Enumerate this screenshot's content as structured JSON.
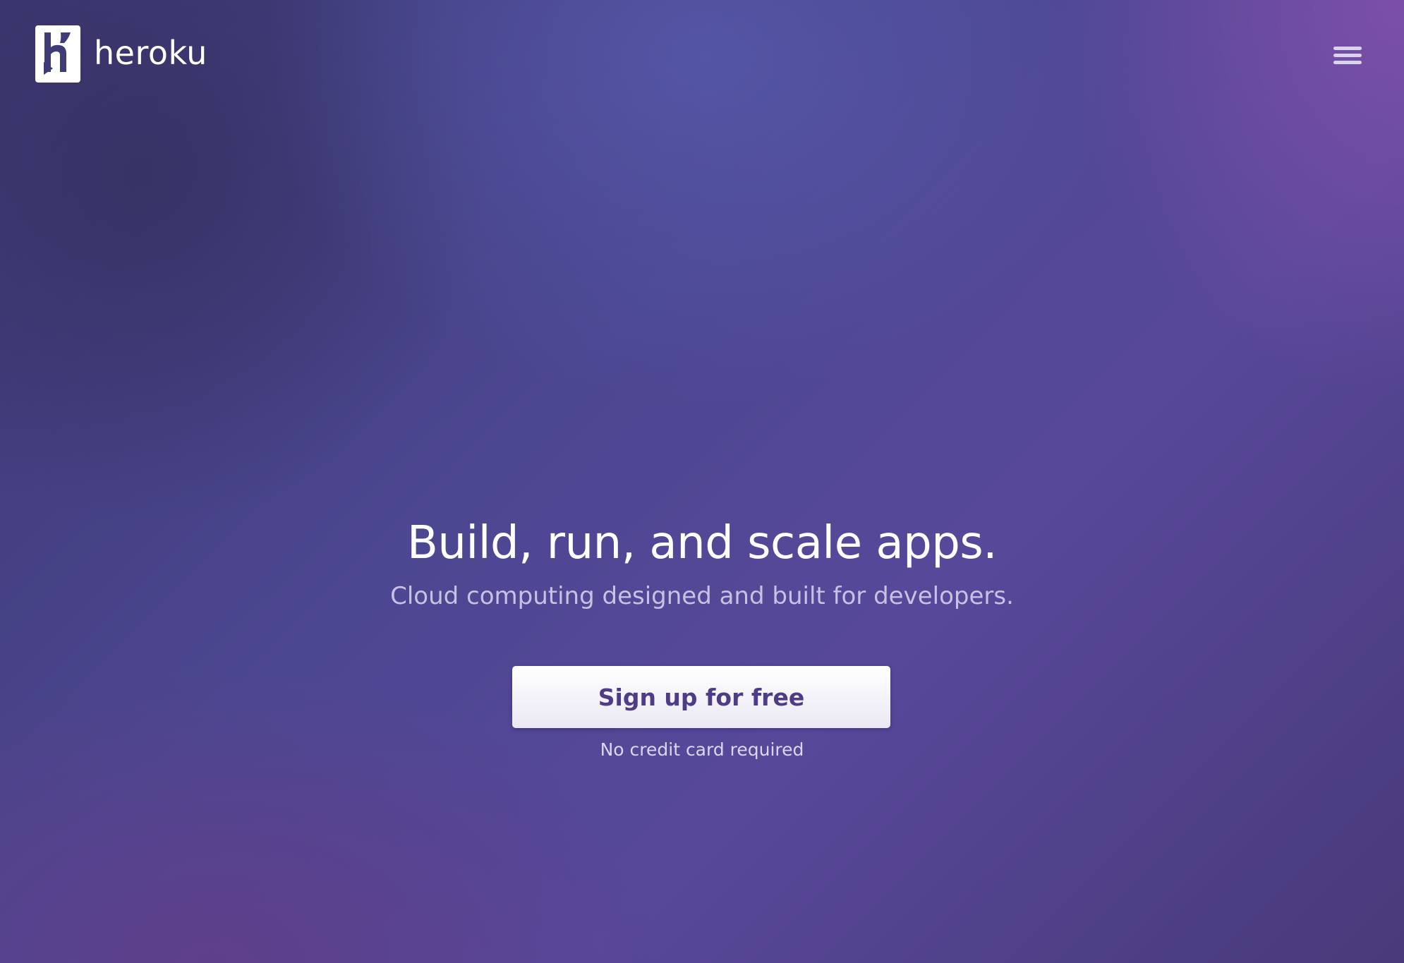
{
  "header": {
    "logo_text": "heroku",
    "logo_icon": "heroku-h-logo-icon",
    "menu_icon": "hamburger-menu-icon"
  },
  "hero": {
    "title": "Build, run, and scale apps.",
    "subtitle": "Cloud computing designed and built for developers.",
    "cta_label": "Sign up for free",
    "cta_note": "No credit card required"
  },
  "colors": {
    "background_primary": "#4c4791",
    "background_accent": "#7a4fa6",
    "cta_text": "#4f3c86",
    "subtitle_text": "#c7c1e3"
  }
}
